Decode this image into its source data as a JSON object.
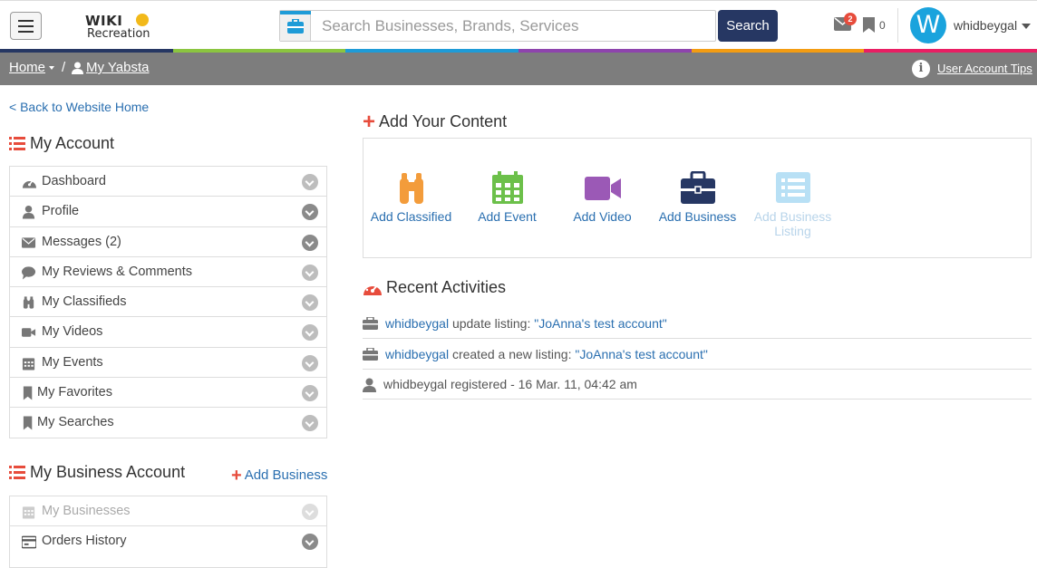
{
  "header": {
    "logo_word": "WIKI",
    "logo_sub": "Recreation",
    "search_placeholder": "Search Businesses, Brands, Services",
    "search_button": "Search",
    "mail_badge": "2",
    "bookmark_count": "0",
    "avatar_letter": "W",
    "username": "whidbeygal"
  },
  "stripe_colors": [
    "#263763",
    "#8bc540",
    "#1e9bd7",
    "#8e44ad",
    "#f39c12",
    "#e91e63"
  ],
  "breadcrumb": {
    "home": "Home",
    "separator": "/",
    "current": "My Yabsta",
    "tips": "User Account Tips"
  },
  "sidebar": {
    "back_link": "< Back to Website Home",
    "my_account": {
      "title": "My Account",
      "items": [
        {
          "label": "Dashboard",
          "icon": "gauge-icon"
        },
        {
          "label": "Profile",
          "icon": "user-icon"
        },
        {
          "label": "Messages (2)",
          "icon": "envelope-icon"
        },
        {
          "label": "My Reviews & Comments",
          "icon": "comment-icon"
        },
        {
          "label": "My Classifieds",
          "icon": "binoculars-icon"
        },
        {
          "label": "My Videos",
          "icon": "video-icon"
        },
        {
          "label": "My Events",
          "icon": "calendar-icon"
        },
        {
          "label": "My Favorites",
          "icon": "bookmark-icon"
        },
        {
          "label": "My Searches",
          "icon": "bookmark-icon"
        }
      ]
    },
    "business_account": {
      "title": "My Business Account",
      "add_link": "Add Business",
      "items": [
        {
          "label": "My Businesses",
          "icon": "calendar-icon"
        },
        {
          "label": "Orders History",
          "icon": "credit-card-icon"
        }
      ]
    }
  },
  "main": {
    "add_content_title": "Add Your Content",
    "tiles": [
      {
        "label": "Add Classified",
        "icon": "binoculars-icon",
        "color": "#f39c3b"
      },
      {
        "label": "Add Event",
        "icon": "calendar-icon",
        "color": "#6cc04a"
      },
      {
        "label": "Add Video",
        "icon": "video-icon",
        "color": "#9b59b6"
      },
      {
        "label": "Add Business",
        "icon": "briefcase-icon",
        "color": "#263763"
      },
      {
        "label": "Add Business Listing",
        "icon": "list-icon",
        "color": "#b8e0f5"
      }
    ],
    "recent_title": "Recent Activities",
    "activities": [
      {
        "user": "whidbeygal",
        "text": " update listing: ",
        "link": "\"JoAnna's test account\""
      },
      {
        "user": "whidbeygal",
        "text": " created a new listing: ",
        "link": "\"JoAnna's test account\""
      },
      {
        "text": "whidbeygal registered - 16 Mar. 11, 04:42 am"
      }
    ]
  }
}
